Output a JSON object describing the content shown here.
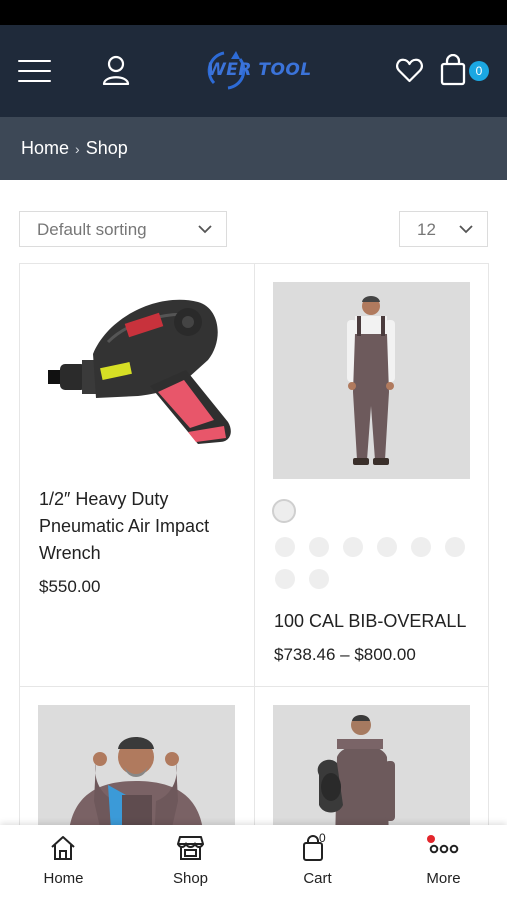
{
  "header": {
    "logo_text": "WER TOOL",
    "cart_badge": "0"
  },
  "breadcrumb": {
    "home": "Home",
    "separator": "›",
    "current": "Shop"
  },
  "toolbar": {
    "sort_value": "Default sorting",
    "per_page_value": "12"
  },
  "products": [
    {
      "title_lines": [
        "1/2″ Heavy Duty",
        "Pneumatic Air Impact",
        "Wrench"
      ],
      "price": "$550.00"
    },
    {
      "title_lines": [
        "100 CAL BIB-OVERALL"
      ],
      "price": "$738.46 – $800.00"
    }
  ],
  "bottom_nav": {
    "home": "Home",
    "shop": "Shop",
    "cart": "Cart",
    "cart_count": "0",
    "more": "More"
  },
  "colors": {
    "header_bg": "#1f2a3a",
    "breadcrumb_bg": "#3d4856",
    "badge": "#1ba7e2",
    "logo": "#3b73d9",
    "notification_dot": "#e3262c"
  }
}
